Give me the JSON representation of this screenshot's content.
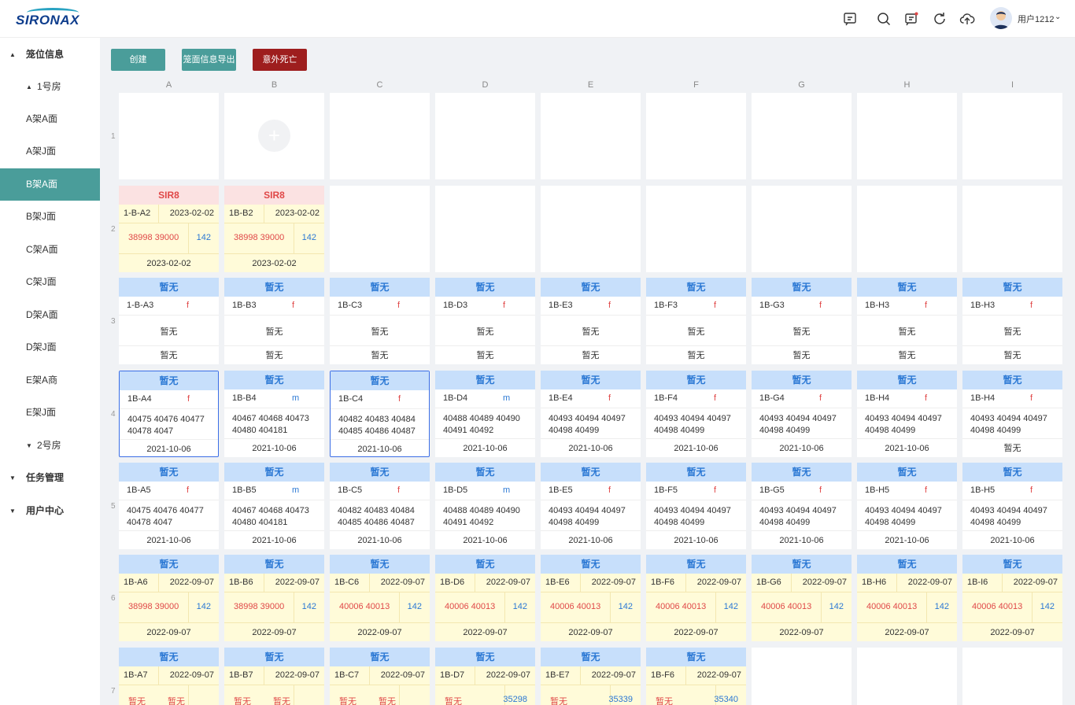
{
  "brand": {
    "logo_text": "SIRONAX"
  },
  "header": {
    "username": "用户1212",
    "icons": [
      "message-icon",
      "search-icon",
      "notification-icon",
      "refresh-icon",
      "upload-icon"
    ]
  },
  "sidebar": {
    "items": [
      {
        "label": "笼位信息",
        "level": 0,
        "caret": "▲",
        "bold": true
      },
      {
        "label": "1号房",
        "level": 1,
        "caret": "▲"
      },
      {
        "label": "A架A面",
        "level": 2
      },
      {
        "label": "A架J面",
        "level": 2
      },
      {
        "label": "B架A面",
        "level": 2,
        "active": true
      },
      {
        "label": "B架J面",
        "level": 2
      },
      {
        "label": "C架A面",
        "level": 2
      },
      {
        "label": "C架J面",
        "level": 2
      },
      {
        "label": "D架A面",
        "level": 2
      },
      {
        "label": "D架J面",
        "level": 2
      },
      {
        "label": "E架A商",
        "level": 2
      },
      {
        "label": "E架J面",
        "level": 2
      },
      {
        "label": "2号房",
        "level": 1,
        "caret": "▼"
      },
      {
        "label": "任务管理",
        "level": 0,
        "caret": "▼",
        "bold": true
      },
      {
        "label": "用户中心",
        "level": 0,
        "caret": "▼",
        "bold": true
      }
    ]
  },
  "toolbar": {
    "create": "创建",
    "export": "笼面信息导出",
    "death": "意外死亡",
    "colors": {
      "create": "#4a9d9a",
      "export": "#4a9d9a",
      "death": "#9e1e1e"
    }
  },
  "grid": {
    "columns": [
      "A",
      "B",
      "C",
      "D",
      "E",
      "F",
      "G",
      "H",
      "I"
    ],
    "rows": [
      "1",
      "2",
      "3",
      "4",
      "5",
      "6",
      "7"
    ],
    "cells": [
      [
        {
          "kind": "empty"
        },
        {
          "kind": "add"
        },
        {
          "kind": "empty"
        },
        {
          "kind": "empty"
        },
        {
          "kind": "empty"
        },
        {
          "kind": "empty"
        },
        {
          "kind": "empty"
        },
        {
          "kind": "empty"
        },
        {
          "kind": "empty"
        }
      ],
      [
        {
          "kind": "yellow",
          "header": "SIR8",
          "headerStyle": "pink",
          "id": "1-B-A2",
          "date": "2023-02-02",
          "ids": "38998 39000",
          "num": "142",
          "footer": "2023-02-02"
        },
        {
          "kind": "yellow",
          "header": "SIR8",
          "headerStyle": "pink",
          "id": "1B-B2",
          "date": "2023-02-02",
          "ids": "38998 39000",
          "num": "142",
          "footer": "2023-02-02"
        },
        {
          "kind": "empty"
        },
        {
          "kind": "empty"
        },
        {
          "kind": "empty"
        },
        {
          "kind": "empty"
        },
        {
          "kind": "empty"
        },
        {
          "kind": "empty"
        },
        {
          "kind": "empty"
        }
      ],
      [
        {
          "kind": "white",
          "header": "暂无",
          "id": "1-B-A3",
          "sex": "f",
          "body": "暂无",
          "center": true,
          "footer": "暂无"
        },
        {
          "kind": "white",
          "header": "暂无",
          "id": "1B-B3",
          "sex": "f",
          "body": "暂无",
          "center": true,
          "footer": "暂无"
        },
        {
          "kind": "white",
          "header": "暂无",
          "id": "1B-C3",
          "sex": "f",
          "body": "暂无",
          "center": true,
          "footer": "暂无"
        },
        {
          "kind": "white",
          "header": "暂无",
          "id": "1B-D3",
          "sex": "f",
          "body": "暂无",
          "center": true,
          "footer": "暂无"
        },
        {
          "kind": "white",
          "header": "暂无",
          "id": "1B-E3",
          "sex": "f",
          "body": "暂无",
          "center": true,
          "footer": "暂无"
        },
        {
          "kind": "white",
          "header": "暂无",
          "id": "1B-F3",
          "sex": "f",
          "body": "暂无",
          "center": true,
          "footer": "暂无"
        },
        {
          "kind": "white",
          "header": "暂无",
          "id": "1B-G3",
          "sex": "f",
          "body": "暂无",
          "center": true,
          "footer": "暂无"
        },
        {
          "kind": "white",
          "header": "暂无",
          "id": "1B-H3",
          "sex": "f",
          "body": "暂无",
          "center": true,
          "footer": "暂无"
        },
        {
          "kind": "white",
          "header": "暂无",
          "id": "1B-H3",
          "sex": "f",
          "body": "暂无",
          "center": true,
          "footer": "暂无"
        }
      ],
      [
        {
          "kind": "white",
          "selected": true,
          "header": "暂无",
          "id": "1B-A4",
          "sex": "f",
          "body": "40475 40476 40477 40478 4047",
          "footer": "2021-10-06"
        },
        {
          "kind": "white",
          "header": "暂无",
          "id": "1B-B4",
          "sex": "m",
          "body": "40467 40468 40473 40480 404181",
          "footer": "2021-10-06"
        },
        {
          "kind": "white",
          "selected": true,
          "header": "暂无",
          "id": "1B-C4",
          "sex": "f",
          "body": "40482 40483 40484 40485 40486 40487",
          "footer": "2021-10-06"
        },
        {
          "kind": "white",
          "header": "暂无",
          "id": "1B-D4",
          "sex": "m",
          "body": "40488 40489 40490 40491 40492",
          "footer": "2021-10-06"
        },
        {
          "kind": "white",
          "header": "暂无",
          "id": "1B-E4",
          "sex": "f",
          "body": "40493 40494 40497 40498 40499",
          "footer": "2021-10-06"
        },
        {
          "kind": "white",
          "header": "暂无",
          "id": "1B-F4",
          "sex": "f",
          "body": "40493 40494 40497 40498 40499",
          "footer": "2021-10-06"
        },
        {
          "kind": "white",
          "header": "暂无",
          "id": "1B-G4",
          "sex": "f",
          "body": "40493 40494 40497 40498 40499",
          "footer": "2021-10-06"
        },
        {
          "kind": "white",
          "header": "暂无",
          "id": "1B-H4",
          "sex": "f",
          "body": "40493 40494 40497 40498 40499",
          "footer": "2021-10-06"
        },
        {
          "kind": "white",
          "header": "暂无",
          "id": "1B-H4",
          "sex": "f",
          "body": "40493 40494 40497 40498 40499",
          "footer": "暂无"
        }
      ],
      [
        {
          "kind": "white",
          "header": "暂无",
          "id": "1B-A5",
          "sex": "f",
          "body": "40475 40476 40477 40478 4047",
          "footer": "2021-10-06"
        },
        {
          "kind": "white",
          "header": "暂无",
          "id": "1B-B5",
          "sex": "m",
          "body": "40467 40468 40473 40480 404181",
          "footer": "2021-10-06"
        },
        {
          "kind": "white",
          "header": "暂无",
          "id": "1B-C5",
          "sex": "f",
          "body": "40482 40483 40484 40485 40486 40487",
          "footer": "2021-10-06"
        },
        {
          "kind": "white",
          "header": "暂无",
          "id": "1B-D5",
          "sex": "m",
          "body": "40488 40489 40490 40491 40492",
          "footer": "2021-10-06"
        },
        {
          "kind": "white",
          "header": "暂无",
          "id": "1B-E5",
          "sex": "f",
          "body": "40493 40494 40497 40498 40499",
          "footer": "2021-10-06"
        },
        {
          "kind": "white",
          "header": "暂无",
          "id": "1B-F5",
          "sex": "f",
          "body": "40493 40494 40497 40498 40499",
          "footer": "2021-10-06"
        },
        {
          "kind": "white",
          "header": "暂无",
          "id": "1B-G5",
          "sex": "f",
          "body": "40493 40494 40497 40498 40499",
          "footer": "2021-10-06"
        },
        {
          "kind": "white",
          "header": "暂无",
          "id": "1B-H5",
          "sex": "f",
          "body": "40493 40494 40497 40498 40499",
          "footer": "2021-10-06"
        },
        {
          "kind": "white",
          "header": "暂无",
          "id": "1B-H5",
          "sex": "f",
          "body": "40493 40494 40497 40498 40499",
          "footer": "2021-10-06"
        }
      ],
      [
        {
          "kind": "yellow",
          "header": "暂无",
          "headerStyle": "blue",
          "id": "1B-A6",
          "date": "2022-09-07",
          "ids": "38998 39000",
          "num": "142",
          "footer": "2022-09-07"
        },
        {
          "kind": "yellow",
          "header": "暂无",
          "headerStyle": "blue",
          "id": "1B-B6",
          "date": "2022-09-07",
          "ids": "38998 39000",
          "num": "142",
          "footer": "2022-09-07"
        },
        {
          "kind": "yellow",
          "header": "暂无",
          "headerStyle": "blue",
          "id": "1B-C6",
          "date": "2022-09-07",
          "ids": "40006 40013",
          "num": "142",
          "footer": "2022-09-07"
        },
        {
          "kind": "yellow",
          "header": "暂无",
          "headerStyle": "blue",
          "id": "1B-D6",
          "date": "2022-09-07",
          "ids": "40006 40013",
          "num": "142",
          "footer": "2022-09-07"
        },
        {
          "kind": "yellow",
          "header": "暂无",
          "headerStyle": "blue",
          "id": "1B-E6",
          "date": "2022-09-07",
          "ids": "40006 40013",
          "num": "142",
          "footer": "2022-09-07"
        },
        {
          "kind": "yellow",
          "header": "暂无",
          "headerStyle": "blue",
          "id": "1B-F6",
          "date": "2022-09-07",
          "ids": "40006 40013",
          "num": "142",
          "footer": "2022-09-07"
        },
        {
          "kind": "yellow",
          "header": "暂无",
          "headerStyle": "blue",
          "id": "1B-G6",
          "date": "2022-09-07",
          "ids": "40006 40013",
          "num": "142",
          "footer": "2022-09-07"
        },
        {
          "kind": "yellow",
          "header": "暂无",
          "headerStyle": "blue",
          "id": "1B-H6",
          "date": "2022-09-07",
          "ids": "40006 40013",
          "num": "142",
          "footer": "2022-09-07"
        },
        {
          "kind": "yellow",
          "header": "暂无",
          "headerStyle": "blue",
          "id": "1B-I6",
          "date": "2022-09-07",
          "ids": "40006 40013",
          "num": "142",
          "footer": "2022-09-07"
        }
      ],
      [
        {
          "kind": "yellow",
          "header": "暂无",
          "headerStyle": "blue",
          "id": "1B-A7",
          "date": "2022-09-07",
          "ids": "暂无",
          "ids2": "暂无",
          "num": "",
          "footer": ""
        },
        {
          "kind": "yellow",
          "header": "暂无",
          "headerStyle": "blue",
          "id": "1B-B7",
          "date": "2022-09-07",
          "ids": "暂无",
          "ids2": "暂无",
          "num": "",
          "footer": ""
        },
        {
          "kind": "yellow",
          "header": "暂无",
          "headerStyle": "blue",
          "id": "1B-C7",
          "date": "2022-09-07",
          "ids": "暂无",
          "ids2": "暂无",
          "num": "",
          "footer": ""
        },
        {
          "kind": "yellow",
          "header": "暂无",
          "headerStyle": "blue",
          "id": "1B-D7",
          "date": "2022-09-07",
          "ids": "暂无",
          "num": "35298",
          "footer": ""
        },
        {
          "kind": "yellow",
          "header": "暂无",
          "headerStyle": "blue",
          "id": "1B-E7",
          "date": "2022-09-07",
          "ids": "暂无",
          "num": "35339",
          "footer": ""
        },
        {
          "kind": "yellow",
          "header": "暂无",
          "headerStyle": "blue",
          "id": "1B-F6",
          "date": "2022-09-07",
          "ids": "暂无",
          "num": "35340",
          "footer": ""
        },
        {
          "kind": "empty"
        },
        {
          "kind": "empty"
        },
        {
          "kind": "empty"
        }
      ]
    ]
  }
}
